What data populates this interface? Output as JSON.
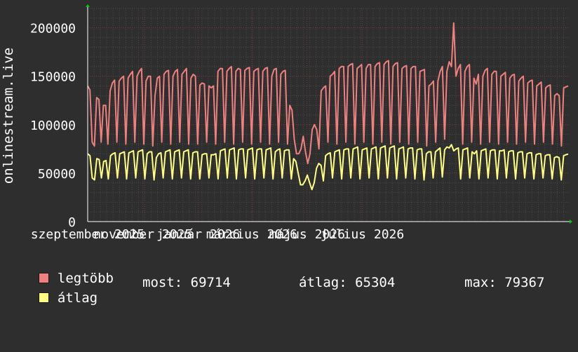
{
  "chart_data": {
    "type": "line",
    "ylabel": "onlinestream.live",
    "ylim": [
      0,
      220000
    ],
    "y_ticks": [
      0,
      50000,
      100000,
      150000,
      200000
    ],
    "x_range_days": [
      0,
      530
    ],
    "x_ticks": [
      {
        "label": "szeptember 2025",
        "day": 0
      },
      {
        "label": "november 2025",
        "day": 61
      },
      {
        "label": "január 2026",
        "day": 122
      },
      {
        "label": "március 2026",
        "day": 181
      },
      {
        "label": "május 2026",
        "day": 242
      },
      {
        "label": "július 2026",
        "day": 303
      }
    ],
    "series": [
      {
        "name": "legtöbb",
        "color": "#f08080",
        "values": [
          140000,
          136000,
          82000,
          78000,
          128000,
          126000,
          82000,
          120000,
          120000,
          80000,
          135000,
          143000,
          146000,
          82000,
          145000,
          148000,
          150000,
          80000,
          148000,
          152000,
          155000,
          82000,
          150000,
          155000,
          158000,
          80000,
          145000,
          150000,
          150000,
          78000,
          130000,
          148000,
          150000,
          82000,
          152000,
          155000,
          156000,
          80000,
          150000,
          155000,
          157000,
          82000,
          152000,
          155000,
          158000,
          80000,
          148000,
          152000,
          150000,
          80000,
          141000,
          143000,
          142000,
          82000,
          140000,
          138000,
          140000,
          80000,
          155000,
          158000,
          158000,
          82000,
          155000,
          158000,
          160000,
          80000,
          155000,
          158000,
          157000,
          82000,
          156000,
          158000,
          159000,
          80000,
          155000,
          157000,
          158000,
          82000,
          155000,
          158000,
          159000,
          80000,
          150000,
          157000,
          158000,
          82000,
          152000,
          155000,
          156000,
          80000,
          120000,
          115000,
          85000,
          70000,
          70000,
          75000,
          88000,
          72000,
          60000,
          70000,
          95000,
          100000,
          95000,
          75000,
          135000,
          138000,
          140000,
          82000,
          150000,
          152000,
          155000,
          80000,
          158000,
          160000,
          160000,
          82000,
          160000,
          162000,
          163000,
          80000,
          158000,
          160000,
          162000,
          82000,
          158000,
          162000,
          162000,
          80000,
          160000,
          163000,
          164000,
          82000,
          162000,
          165000,
          166000,
          80000,
          160000,
          163000,
          164000,
          82000,
          158000,
          160000,
          161000,
          80000,
          158000,
          160000,
          160000,
          82000,
          155000,
          156000,
          157000,
          78000,
          140000,
          142000,
          145000,
          82000,
          145000,
          155000,
          160000,
          85000,
          155000,
          165000,
          160000,
          205000,
          150000,
          158000,
          162000,
          80000,
          155000,
          160000,
          162000,
          82000,
          148000,
          142000,
          152000,
          80000,
          150000,
          156000,
          158000,
          82000,
          152000,
          155000,
          155000,
          80000,
          150000,
          152000,
          154000,
          82000,
          148000,
          151000,
          152000,
          80000,
          145000,
          148000,
          150000,
          82000,
          143000,
          145000,
          146000,
          80000,
          140000,
          142000,
          144000,
          82000,
          138000,
          140000,
          141000,
          80000,
          130000,
          132000,
          130000,
          78000,
          138000,
          139000,
          140000
        ]
      },
      {
        "name": "átlag",
        "color": "#ffff80",
        "values": [
          70000,
          68000,
          45000,
          43000,
          65000,
          64000,
          45000,
          62000,
          63000,
          44000,
          68000,
          70000,
          71000,
          45000,
          70000,
          71000,
          72000,
          44000,
          71000,
          72000,
          73000,
          45000,
          72000,
          73000,
          74000,
          44000,
          70000,
          72000,
          72000,
          43000,
          66000,
          70000,
          71000,
          45000,
          72000,
          73000,
          74000,
          44000,
          72000,
          73000,
          74000,
          45000,
          72000,
          73000,
          74000,
          44000,
          71000,
          72000,
          72000,
          44000,
          69000,
          70000,
          70000,
          45000,
          69000,
          69000,
          70000,
          44000,
          73000,
          74000,
          75000,
          45000,
          74000,
          75000,
          76000,
          44000,
          74000,
          75000,
          75000,
          45000,
          74000,
          75000,
          76000,
          44000,
          74000,
          75000,
          75000,
          45000,
          74000,
          75000,
          76000,
          44000,
          72000,
          74000,
          75000,
          45000,
          73000,
          74000,
          74000,
          44000,
          65000,
          62000,
          50000,
          38000,
          38000,
          42000,
          48000,
          40000,
          33000,
          40000,
          55000,
          60000,
          58000,
          42000,
          68000,
          70000,
          71000,
          45000,
          72000,
          73000,
          74000,
          44000,
          74000,
          75000,
          75000,
          45000,
          75000,
          76000,
          77000,
          44000,
          74000,
          75000,
          76000,
          45000,
          75000,
          76000,
          77000,
          44000,
          76000,
          77000,
          78000,
          45000,
          76000,
          77000,
          78000,
          44000,
          75000,
          76000,
          77000,
          45000,
          75000,
          76000,
          76000,
          44000,
          74000,
          75000,
          75000,
          43000,
          70000,
          72000,
          72000,
          45000,
          72000,
          74000,
          76000,
          46000,
          74000,
          77000,
          76000,
          79367,
          73000,
          75000,
          76000,
          44000,
          74000,
          75000,
          76000,
          45000,
          72000,
          70000,
          73000,
          44000,
          73000,
          74000,
          75000,
          45000,
          73000,
          74000,
          74000,
          44000,
          73000,
          73000,
          74000,
          45000,
          72000,
          73000,
          73000,
          44000,
          71000,
          72000,
          72000,
          45000,
          70000,
          71000,
          71000,
          44000,
          69000,
          70000,
          70000,
          45000,
          68000,
          69000,
          69000,
          44000,
          66000,
          67000,
          66000,
          43000,
          68000,
          69000,
          69714
        ]
      }
    ],
    "legend": {
      "max_label": "legtöbb",
      "avg_label": "átlag",
      "most": "most: 69714",
      "atlag": "átlag: 65304",
      "max": "max: 79367"
    },
    "colors": {
      "background": "#2e2e2e",
      "plot_bg": "#2e2e2e",
      "grid_minor": "#4a4a4a",
      "grid_major": "#7a3a3a",
      "axis": "#ffffff",
      "arrow": "#00cc00"
    }
  }
}
